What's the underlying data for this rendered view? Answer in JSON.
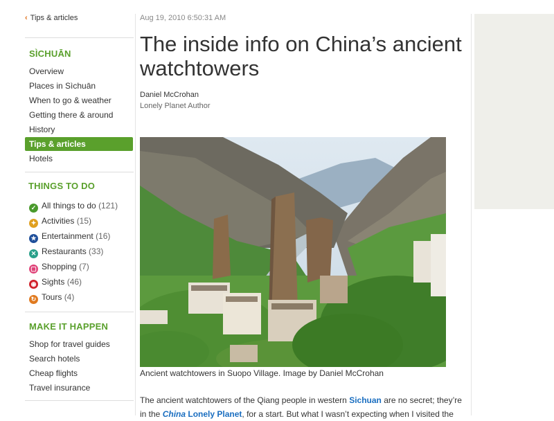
{
  "sidebar": {
    "back_link": "Tips & articles",
    "region_title": "SÌCHUĀN",
    "nav": [
      "Overview",
      "Places in Sìchuān",
      "When to go & weather",
      "Getting there & around",
      "History",
      "Tips & articles",
      "Hotels"
    ],
    "things_title": "THINGS TO DO",
    "things": [
      {
        "label": "All things to do",
        "count": "(121)",
        "icon": "check-icon",
        "color": "#4a9a2c"
      },
      {
        "label": "Activities",
        "count": "(15)",
        "icon": "activities-icon",
        "color": "#e0a020"
      },
      {
        "label": "Entertainment",
        "count": "(16)",
        "icon": "star-icon",
        "color": "#1f4f9a"
      },
      {
        "label": "Restaurants",
        "count": "(33)",
        "icon": "cutlery-icon",
        "color": "#2aa08a"
      },
      {
        "label": "Shopping",
        "count": "(7)",
        "icon": "bag-icon",
        "color": "#e0457a"
      },
      {
        "label": "Sights",
        "count": "(46)",
        "icon": "eye-icon",
        "color": "#d0202a"
      },
      {
        "label": "Tours",
        "count": "(4)",
        "icon": "tours-icon",
        "color": "#e07a20"
      }
    ],
    "make_title": "MAKE IT HAPPEN",
    "make": [
      "Shop for travel guides",
      "Search hotels",
      "Cheap flights",
      "Travel insurance"
    ]
  },
  "article": {
    "timestamp": "Aug 19, 2010 6:50:31 AM",
    "title": "The inside info on China’s ancient watchtowers",
    "author": "Daniel McCrohan",
    "author_role": "Lonely Planet Author",
    "caption": "Ancient watchtowers in Suopo Village. Image by Daniel McCrohan",
    "para_line1_a": "The ancient watchtowers of the Qiang people in western ",
    "para_line1_link": "Sichuan",
    "para_line1_b": " are no secret; they’re",
    "para_line2_a": "in the ",
    "para_line2_link1": "China",
    "para_line2_link2": "Lonely Planet",
    "para_line2_b": ", for a start. But what I wasn’t expecting when I visited the"
  },
  "colors": {
    "accent_green": "#5aa02c",
    "link_blue": "#1a6ec0"
  }
}
